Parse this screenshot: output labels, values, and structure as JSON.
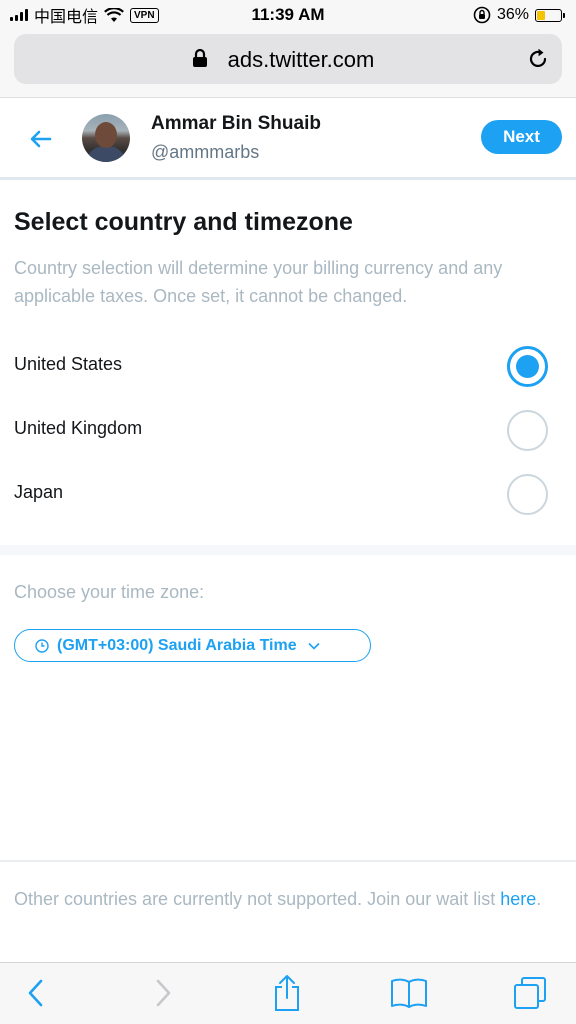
{
  "status_bar": {
    "carrier": "中国电信",
    "vpn": "VPN",
    "time": "11:39 AM",
    "battery": "36%",
    "battery_level": 0.36
  },
  "browser": {
    "url": "ads.twitter.com"
  },
  "header": {
    "name": "Ammar Bin Shuaib",
    "handle": "@ammmarbs",
    "next_label": "Next"
  },
  "main": {
    "title": "Select country and timezone",
    "description": "Country selection will determine your billing currency and any applicable taxes. Once set, it cannot be changed.",
    "countries": [
      {
        "label": "United States",
        "selected": true
      },
      {
        "label": "United Kingdom",
        "selected": false
      },
      {
        "label": "Japan",
        "selected": false
      }
    ],
    "timezone_label": "Choose your time zone:",
    "timezone_value": "(GMT+03:00) Saudi Arabia Time"
  },
  "footer": {
    "text": "Other countries are currently not supported. Join our wait list ",
    "link": "here",
    "suffix": "."
  },
  "colors": {
    "accent": "#1da1f2",
    "muted_text": "#aab8c2",
    "battery_fill": "#f5c400"
  },
  "icons": [
    "signal-icon",
    "wifi-icon",
    "lock-icon",
    "reload-icon",
    "orientation-lock-icon",
    "battery-icon",
    "back-arrow-icon",
    "clock-icon",
    "chevron-down-icon",
    "toolbar-back-icon",
    "toolbar-forward-icon",
    "share-icon",
    "bookmarks-icon",
    "tabs-icon"
  ]
}
